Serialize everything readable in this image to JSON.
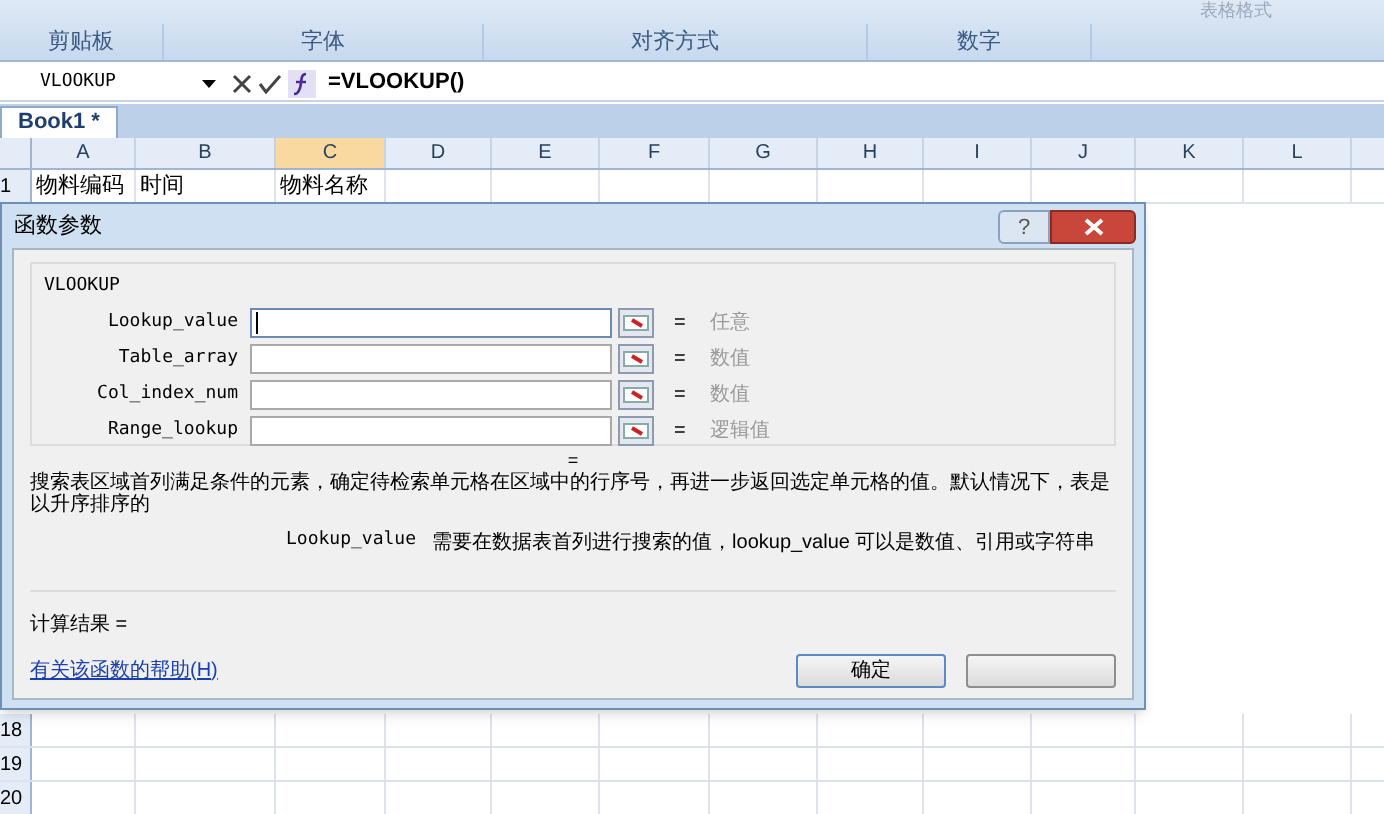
{
  "ribbon": {
    "cut_label": "表格格式",
    "groups": [
      {
        "label": "剪贴板"
      },
      {
        "label": "字体"
      },
      {
        "label": "对齐方式"
      },
      {
        "label": "数字"
      }
    ]
  },
  "formula_bar": {
    "name_box": "VLOOKUP",
    "formula": "=VLOOKUP()"
  },
  "sheet_tabs": [
    {
      "label": "Book1 *",
      "selected": true
    }
  ],
  "columns": [
    {
      "label": "A",
      "selected": false
    },
    {
      "label": "B",
      "selected": false
    },
    {
      "label": "C",
      "selected": true
    },
    {
      "label": "D",
      "selected": false
    },
    {
      "label": "E",
      "selected": false
    },
    {
      "label": "F",
      "selected": false
    },
    {
      "label": "G",
      "selected": false
    },
    {
      "label": "H",
      "selected": false
    },
    {
      "label": "I",
      "selected": false
    },
    {
      "label": "J",
      "selected": false
    },
    {
      "label": "K",
      "selected": false
    },
    {
      "label": "L",
      "selected": false
    }
  ],
  "rows": [
    {
      "number": "1",
      "cells": [
        "物料编码",
        "时间",
        "物料名称"
      ]
    },
    {
      "number": "18",
      "cells": []
    },
    {
      "number": "19",
      "cells": []
    },
    {
      "number": "20",
      "cells": []
    }
  ],
  "dialog": {
    "title": "函数参数",
    "help_button": "?",
    "function_name": "VLOOKUP",
    "arguments": [
      {
        "name": "Lookup_value",
        "equals": "=",
        "result": "任意",
        "focused": true
      },
      {
        "name": "Table_array",
        "equals": "=",
        "result": "数值",
        "focused": false
      },
      {
        "name": "Col_index_num",
        "equals": "=",
        "result": "数值",
        "focused": false
      },
      {
        "name": "Range_lookup",
        "equals": "=",
        "result": "逻辑值",
        "focused": false
      }
    ],
    "result_sign": "=",
    "description": "搜索表区域首列满足条件的元素，确定待检索单元格在区域中的行序号，再进一步返回选定单元格的值。默认情况下，表是以升序排序的",
    "arg_help_name": "Lookup_value",
    "arg_help_text": "需要在数据表首列进行搜索的值，lookup_value 可以是数值、引用或字符串",
    "result_label": "计算结果 =",
    "help_link": "有关该函数的帮助(H)",
    "ok_button": "确定"
  }
}
